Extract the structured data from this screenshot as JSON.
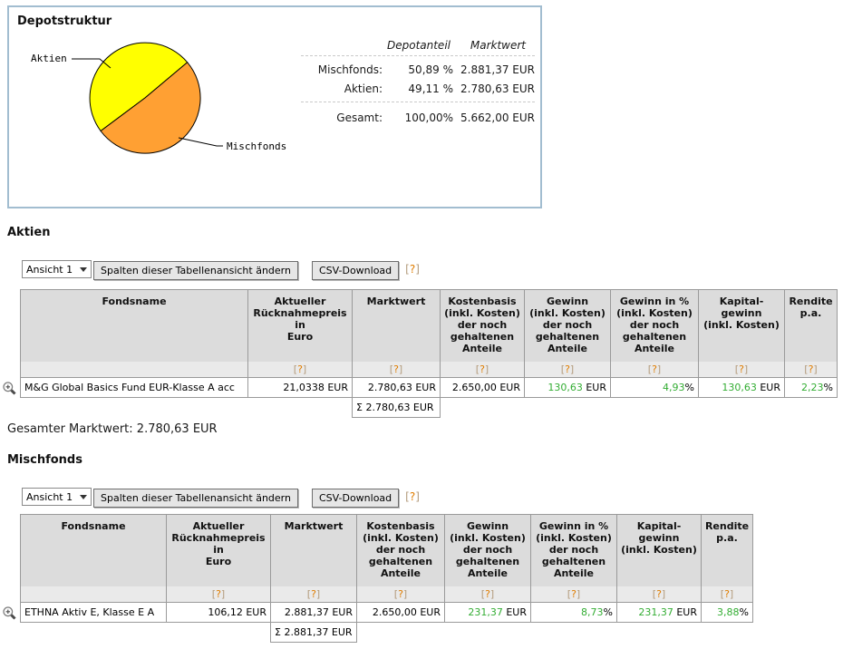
{
  "depot": {
    "title": "Depotstruktur",
    "summary": {
      "share_header": "Depotanteil",
      "value_header": "Marktwert",
      "rows": [
        {
          "label": "Mischfonds:",
          "share": "50,89 %",
          "value": "2.881,37 EUR"
        },
        {
          "label": "Aktien:",
          "share": "49,11 %",
          "value": "2.780,63 EUR"
        }
      ],
      "total": {
        "label": "Gesamt:",
        "share": "100,00%",
        "value": "5.662,00 EUR"
      }
    }
  },
  "chart_data": {
    "type": "pie",
    "title": "Depotstruktur",
    "slices": [
      {
        "label": "Aktien",
        "value_pct": 49.11,
        "value": "2.780,63 EUR",
        "color": "#ffff00"
      },
      {
        "label": "Mischfonds",
        "value_pct": 50.89,
        "value": "2.881,37 EUR",
        "color": "#ffa033"
      }
    ],
    "total": {
      "label": "Gesamt",
      "value_pct": 100.0,
      "value": "5.662,00 EUR"
    },
    "legend_position": "callout-labels"
  },
  "help": {
    "open": "[",
    "q": "?",
    "close": "]"
  },
  "controls": {
    "view": "Ansicht 1",
    "change_columns": "Spalten dieser Tabellenansicht ändern",
    "csv": "CSV-Download"
  },
  "columns": [
    "Fondsname",
    "Aktueller\nRücknahmepreis\nin\nEuro",
    "Marktwert",
    "Kostenbasis\n(inkl. Kosten)\nder noch\ngehaltenen\nAnteile",
    "Gewinn\n(inkl. Kosten)\nder noch\ngehaltenen\nAnteile",
    "Gewinn in %\n(inkl. Kosten)\nder noch\ngehaltenen\nAnteile",
    "Kapital-\ngewinn\n(inkl. Kosten)",
    "Rendite\np.a."
  ],
  "sum_symbol": "Σ",
  "aktien": {
    "heading": "Aktien",
    "row": {
      "name": "M&G Global Basics Fund EUR-Klasse A acc",
      "price": "21,0338 EUR",
      "marktwert": "2.780,63 EUR",
      "kostenbasis": "2.650,00 EUR",
      "gewinn": "130,63",
      "gewinn_unit": "EUR",
      "gewinn_pct": "4,93",
      "pct_sign": "%",
      "kapitalgewinn": "130,63",
      "kapitalgewinn_unit": "EUR",
      "rendite": "2,23",
      "rendite_sign": "%"
    },
    "sum_value": "2.780,63 EUR",
    "footer_label": "Gesamter Marktwert:",
    "footer_value": "2.780,63 EUR"
  },
  "mischfonds": {
    "heading": "Mischfonds",
    "row": {
      "name": "ETHNA Aktiv E, Klasse E A",
      "price": "106,12 EUR",
      "marktwert": "2.881,37 EUR",
      "kostenbasis": "2.650,00 EUR",
      "gewinn": "231,37",
      "gewinn_unit": "EUR",
      "gewinn_pct": "8,73",
      "pct_sign": "%",
      "kapitalgewinn": "231,37",
      "kapitalgewinn_unit": "EUR",
      "rendite": "3,88",
      "rendite_sign": "%"
    },
    "sum_value": "2.881,37 EUR"
  },
  "colors": {
    "positive_green": "#33ad33",
    "help_orange": "#e07d00",
    "panel_border": "#a2bdd0",
    "slice_aktien": "#ffff00",
    "slice_mischfonds": "#ffa033",
    "table_header_bg": "#dcdcdc"
  }
}
